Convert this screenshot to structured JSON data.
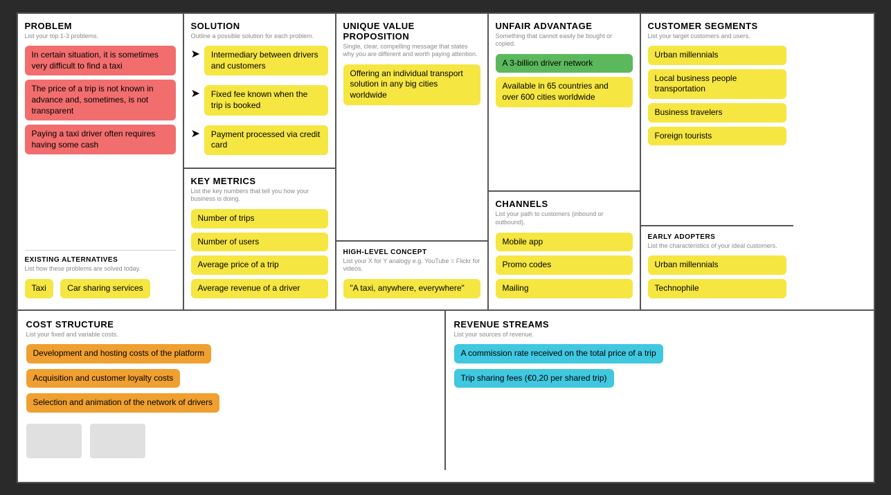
{
  "canvas": {
    "problem": {
      "title": "PROBLEM",
      "subtitle": "List your top 1-3 problems.",
      "tags": [
        "In certain situation, it is sometimes very difficult to find a taxi",
        "The price of a trip is not known in advance and, sometimes, is not transparent",
        "Paying a taxi driver often requires having some cash"
      ],
      "existing_alternatives_title": "EXISTING ALTERNATIVES",
      "existing_alternatives_subtitle": "List how these problems are solved today.",
      "alternatives": [
        "Taxi",
        "Car sharing services"
      ]
    },
    "solution": {
      "title": "SOLUTION",
      "subtitle": "Outline a possible solution for each problem.",
      "tags": [
        "Intermediary between drivers and customers",
        "Fixed fee known when the trip is booked",
        "Payment processed via credit card"
      ],
      "key_metrics": {
        "title": "KEY METRICS",
        "subtitle": "List the key numbers that tell you how your business is doing.",
        "tags": [
          "Number of trips",
          "Number of users",
          "Average price of a trip",
          "Average revenue of a driver"
        ]
      }
    },
    "uvp": {
      "title": "UNIQUE VALUE PROPOSITION",
      "subtitle": "Single, clear, compelling message that states why you are different and worth paying attention.",
      "tag": "Offering an individual transport solution in any big cities worldwide",
      "high_level_concept": {
        "title": "HIGH-LEVEL CONCEPT",
        "subtitle": "List your X for Y analogy e.g. YouTube = Flickr for videos.",
        "tag": "\"A taxi, anywhere, everywhere\""
      }
    },
    "unfair_advantage": {
      "title": "UNFAIR ADVANTAGE",
      "subtitle": "Something that cannot easily be bought or copied.",
      "tags_green": [
        "A 3-billion driver network"
      ],
      "tags_yellow": [
        "Available in 65 countries and over 600 cities worldwide"
      ],
      "channels": {
        "title": "CHANNELS",
        "subtitle": "List your path to customers (inbound or outbound).",
        "tags": [
          "Mobile app",
          "Promo codes",
          "Mailing"
        ]
      }
    },
    "customer_segments": {
      "title": "CUSTOMER SEGMENTS",
      "subtitle": "List your target customers and users.",
      "tags": [
        "Urban millennials",
        "Local business people transportation",
        "Business travelers",
        "Foreign tourists"
      ],
      "early_adopters": {
        "title": "EARLY ADOPTERS",
        "subtitle": "List the characteristics of your ideal customers.",
        "tags": [
          "Urban millennials",
          "Technophile"
        ]
      }
    },
    "cost_structure": {
      "title": "COST STRUCTURE",
      "subtitle": "List your fixed and variable costs.",
      "tags": [
        "Development and hosting costs of the platform",
        "Acquisition and customer loyalty costs",
        "Selection and animation of the network of drivers"
      ]
    },
    "revenue_streams": {
      "title": "REVENUE STREAMS",
      "subtitle": "List your sources of revenue.",
      "tags": [
        "A commission rate received on the total price of a trip",
        "Trip sharing fees (€0,20 per shared trip)"
      ]
    }
  }
}
